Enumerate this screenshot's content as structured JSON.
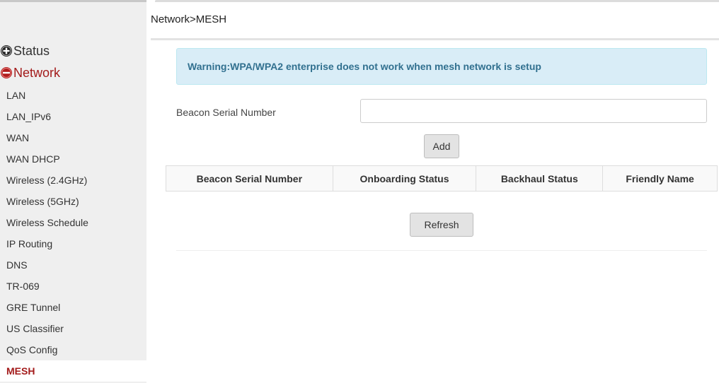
{
  "sidebar": {
    "sections": {
      "status": {
        "label": "Status",
        "icon": "plus-circle-icon"
      },
      "network": {
        "label": "Network",
        "icon": "minus-circle-icon"
      }
    },
    "items": [
      {
        "label": "LAN"
      },
      {
        "label": "LAN_IPv6"
      },
      {
        "label": "WAN"
      },
      {
        "label": "WAN DHCP"
      },
      {
        "label": "Wireless (2.4GHz)"
      },
      {
        "label": "Wireless (5GHz)"
      },
      {
        "label": "Wireless Schedule"
      },
      {
        "label": "IP Routing"
      },
      {
        "label": "DNS"
      },
      {
        "label": "TR-069"
      },
      {
        "label": "GRE Tunnel"
      },
      {
        "label": "US Classifier"
      },
      {
        "label": "QoS Config"
      },
      {
        "label": "MESH",
        "active": true
      }
    ]
  },
  "header": {
    "breadcrumb": "Network>MESH"
  },
  "main": {
    "warning": "Warning:WPA/WPA2 enterprise does not work when mesh network is setup",
    "form": {
      "serial_label": "Beacon Serial Number",
      "serial_value": "",
      "add_label": "Add"
    },
    "table": {
      "columns": [
        "Beacon Serial Number",
        "Onboarding Status",
        "Backhaul Status",
        "Friendly Name"
      ]
    },
    "refresh_label": "Refresh"
  },
  "colors": {
    "accent": "#a31b1b",
    "warning_bg": "#d9edf7",
    "warning_text": "#31708f",
    "sidebar_bg": "#efefef"
  }
}
